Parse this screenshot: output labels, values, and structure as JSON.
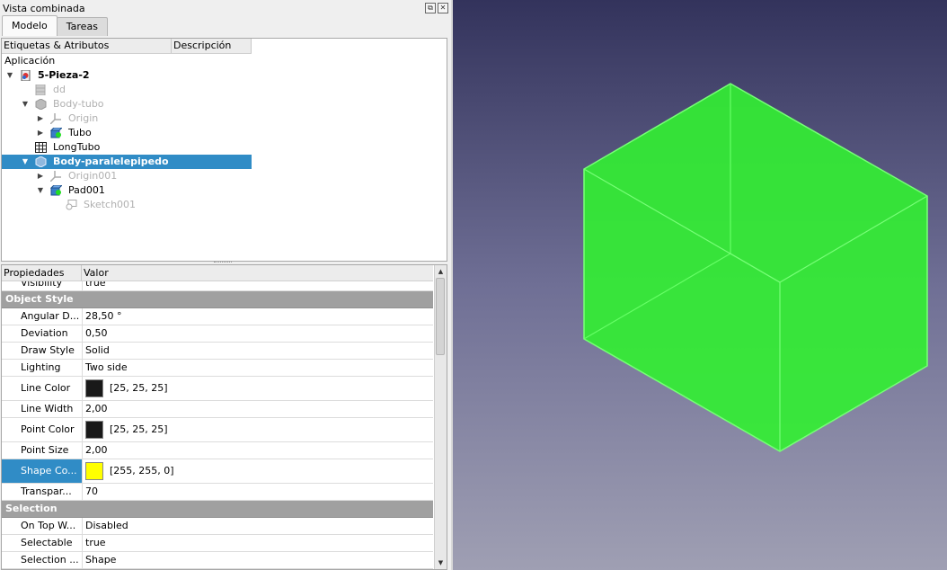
{
  "dock": {
    "title": "Vista combinada",
    "float_glyph": "⧉",
    "close_glyph": "✕"
  },
  "tabs": [
    {
      "label": "Modelo"
    },
    {
      "label": "Tareas"
    }
  ],
  "tree": {
    "columns": [
      "Etiquetas & Atributos",
      "Descripción"
    ],
    "root_label": "Aplicación",
    "items": [
      {
        "label": "5-Pieza-2",
        "icon": "document-icon",
        "expanded": true
      },
      {
        "label": "dd",
        "icon": "spreadsheet-disabled-icon"
      },
      {
        "label": "Body-tubo",
        "icon": "body-icon",
        "expanded": true
      },
      {
        "label": "Origin",
        "icon": "origin-axes-icon",
        "collapsed": true
      },
      {
        "label": "Tubo",
        "icon": "pad-feature-icon",
        "collapsed": true
      },
      {
        "label": "LongTubo",
        "icon": "spreadsheet-icon"
      },
      {
        "label": "Body-paralelepipedo",
        "icon": "body-icon",
        "expanded": true,
        "selected": true
      },
      {
        "label": "Origin001",
        "icon": "origin-axes-icon",
        "collapsed": true
      },
      {
        "label": "Pad001",
        "icon": "pad-feature-icon",
        "expanded": true
      },
      {
        "label": "Sketch001",
        "icon": "sketch-icon"
      }
    ]
  },
  "properties": {
    "columns": [
      "Propiedades",
      "Valor"
    ],
    "partial_row": {
      "name": "Visibility",
      "value": "true"
    },
    "groups": [
      {
        "name": "Object Style",
        "rows": [
          {
            "name": "Angular D...",
            "value": "28,50 °"
          },
          {
            "name": "Deviation",
            "value": "0,50"
          },
          {
            "name": "Draw Style",
            "value": "Solid"
          },
          {
            "name": "Lighting",
            "value": "Two side"
          },
          {
            "name": "Line Color",
            "value": "[25, 25, 25]",
            "color": "#191919"
          },
          {
            "name": "Line Width",
            "value": "2,00"
          },
          {
            "name": "Point Color",
            "value": "[25, 25, 25]",
            "color": "#191919"
          },
          {
            "name": "Point Size",
            "value": "2,00"
          },
          {
            "name": "Shape Co...",
            "value": "[255, 255, 0]",
            "color": "#ffff00",
            "selected": true
          },
          {
            "name": "Transpar...",
            "value": "70"
          }
        ]
      },
      {
        "name": "Selection",
        "rows": [
          {
            "name": "On Top W...",
            "value": "Disabled"
          },
          {
            "name": "Selectable",
            "value": "true"
          },
          {
            "name": "Selection ...",
            "value": "Shape"
          }
        ]
      }
    ]
  },
  "viewport": {
    "shape_color": "#33ff33",
    "edge_color": "#66ff66"
  }
}
